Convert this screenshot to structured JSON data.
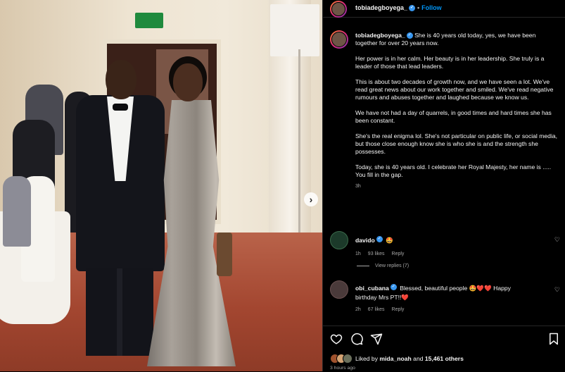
{
  "header": {
    "username": "tobiadegboyega_",
    "follow_label": "Follow"
  },
  "caption": {
    "username": "tobiadegboyega_",
    "paragraphs": [
      "She is 40 years old today, yes, we have been together for over 20 years now.",
      "Her power is in her calm. Her beauty is in her leadership. She truly is a leader of those that lead leaders.",
      "This is about two decades of growth now, and we have seen a lot. We've read great news about our work together and smiled. We've read negative rumours and abuses together and laughed because we know us.",
      "We have not had a day of quarrels, in good times and hard times she has been constant.",
      "She's the real enigma lol. She's not particular on public life, or social media, but those close enough know she is who she is and the strength she possesses.",
      "Today, she is 40 years old. I celebrate her Royal Majesty, her name is ..... You fill in the gap."
    ],
    "time": "3h"
  },
  "comments": [
    {
      "username": "davido",
      "text": "🤩",
      "time": "1h",
      "likes": "93 likes",
      "reply_label": "Reply",
      "view_replies": "View replies (7)"
    },
    {
      "username": "obi_cubana",
      "text": "Blessed, beautiful people 🤩❤️❤️ Happy birthday Mrs PT!!❤️",
      "time": "2h",
      "likes": "67 likes",
      "reply_label": "Reply"
    }
  ],
  "actions": {
    "liked_prefix": "Liked by",
    "liked_user": "mida_noah",
    "liked_middle": "and",
    "liked_count": "15,461 others",
    "posted": "3 hours ago"
  },
  "icons": {
    "verified": "verified-badge-icon",
    "heart": "heart-icon",
    "comment": "comment-icon",
    "share": "share-icon",
    "save": "bookmark-icon",
    "next": "chevron-right-icon"
  },
  "colors": {
    "follow": "#0095f6",
    "verified": "#3897f0",
    "heart_red": "#ed4956"
  }
}
